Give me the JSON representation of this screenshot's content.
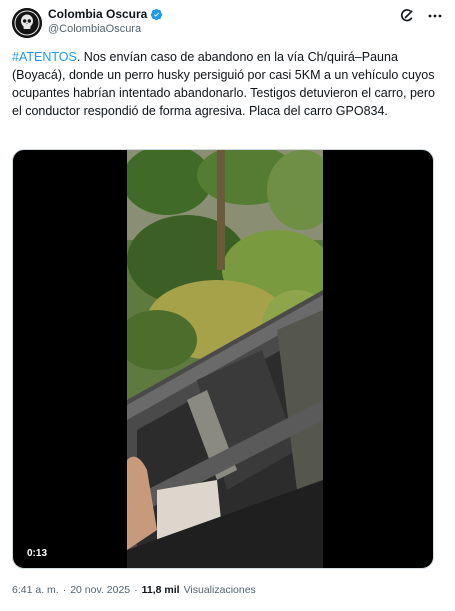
{
  "author": {
    "display_name": "Colombia Oscura",
    "handle": "@ColombiaOscura",
    "verified": true,
    "avatar_icon": "skull-logo-icon"
  },
  "header_actions": [
    "grok-icon",
    "more-icon"
  ],
  "tweet": {
    "hashtag": "#ATENTOS",
    "text": ". Nos envían caso de abandono en la vía Ch/quirá–Pauna (Boyacá), donde un perro husky persiguió por casi 5KM a un vehículo cuyos ocupantes habrían intentado abandonarlo. Testigos detuvieron el carro, pero el conductor respondió de forma agresiva. Placa del carro GPO834."
  },
  "media": {
    "video_time": "0:13"
  },
  "footer": {
    "time": "6:41 a. m.",
    "separator": "·",
    "date": "20 nov. 2025",
    "views_count": "11,8 mil",
    "views_label": "Visualizaciones"
  },
  "colors": {
    "link": "#1d9bf0",
    "text": "#0f1419",
    "secondary": "#536471"
  }
}
